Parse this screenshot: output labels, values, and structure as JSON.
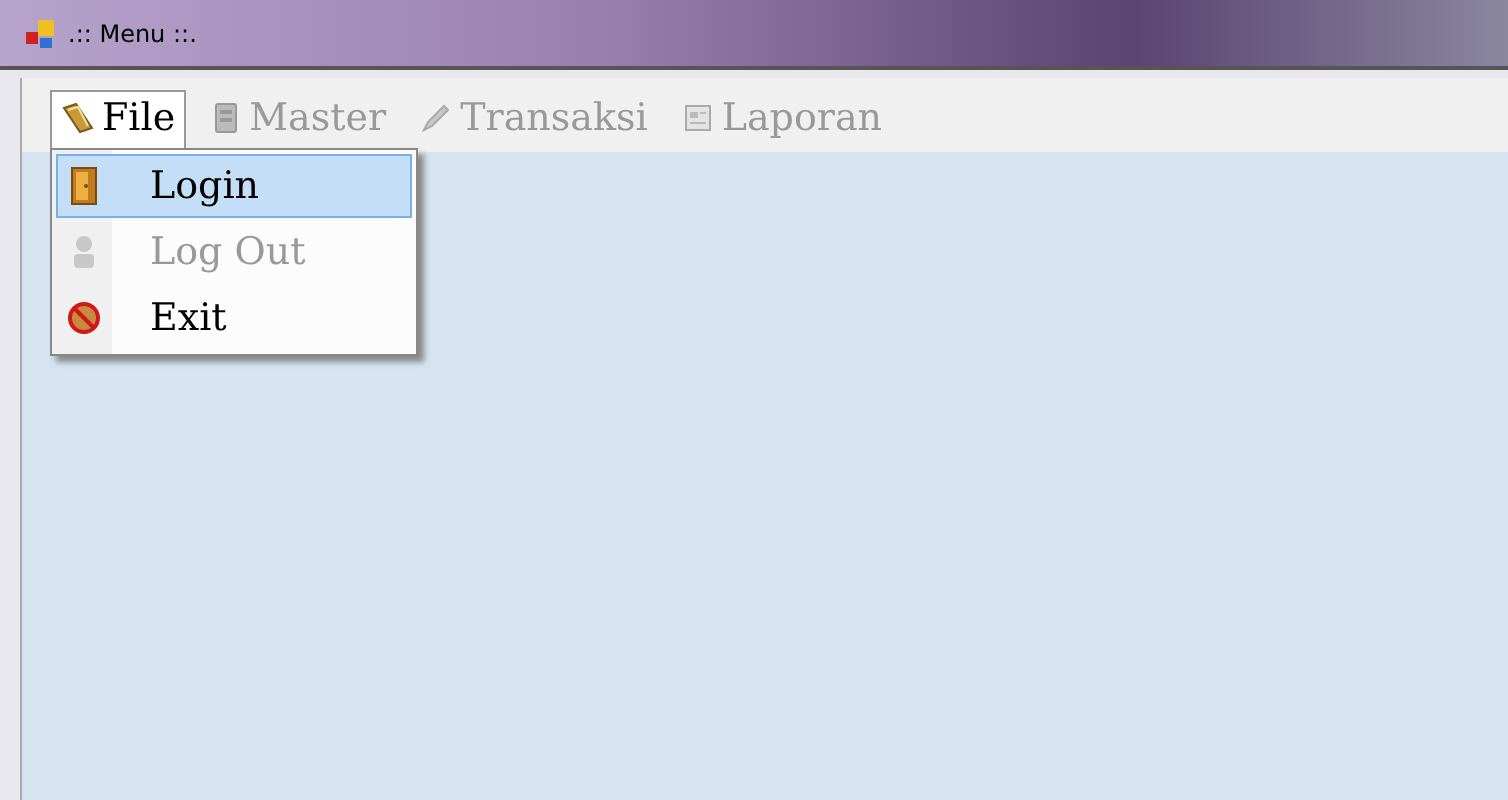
{
  "window": {
    "title": ".:: Menu ::."
  },
  "menu": [
    {
      "label": "File",
      "selected": true,
      "disabled": false
    },
    {
      "label": "Master",
      "selected": false,
      "disabled": true
    },
    {
      "label": "Transaksi",
      "selected": false,
      "disabled": true
    },
    {
      "label": "Laporan",
      "selected": false,
      "disabled": true
    }
  ],
  "dropdown": {
    "items": [
      {
        "label": "Login",
        "selected": true,
        "disabled": false
      },
      {
        "label": "Log Out",
        "selected": false,
        "disabled": true
      },
      {
        "label": "Exit",
        "selected": false,
        "disabled": false
      }
    ]
  }
}
